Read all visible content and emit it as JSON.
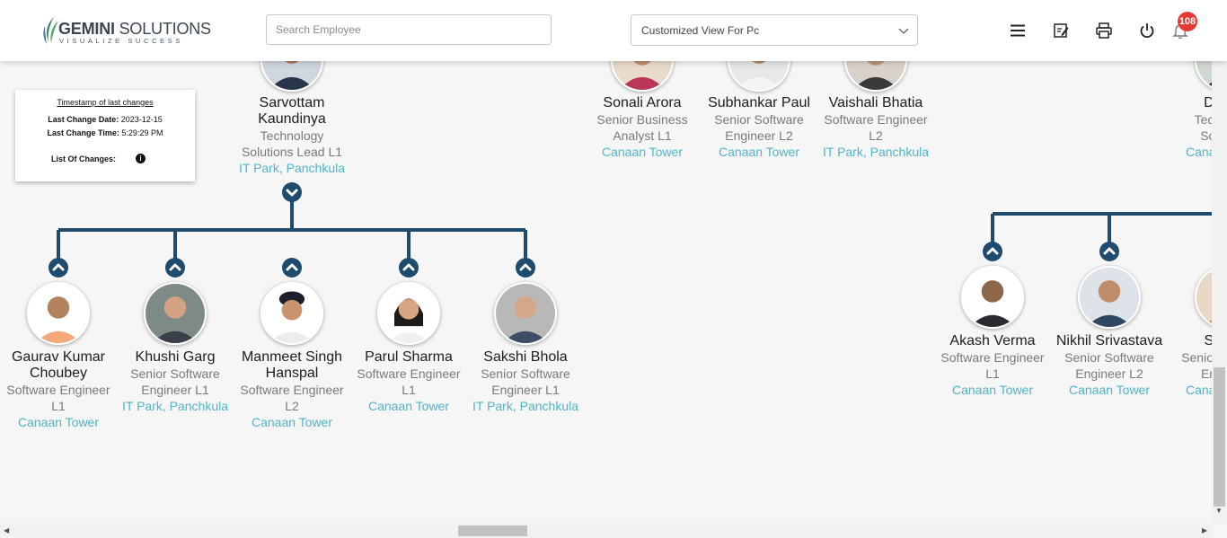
{
  "header": {
    "brand_name_bold": "GEMINI",
    "brand_name_thin": "SOLUTIONS",
    "brand_tagline": "VISUALIZE SUCCESS",
    "search_placeholder": "Search Employee",
    "view_selected": "Customized View For Pc",
    "notification_count": "108",
    "icons": [
      "menu-icon",
      "edit-note-icon",
      "printer-icon",
      "power-icon",
      "bell-icon"
    ]
  },
  "timestamp_card": {
    "title": "Timestamp of last changes",
    "date_label": "Last Change Date:",
    "date_value": "2023-12-15",
    "time_label": "Last Change Time:",
    "time_value": "5:29:29 PM",
    "changes_label": "List Of Changes:"
  },
  "top_row": [
    {
      "name": "Sarvottam Kaundinya",
      "designation": "Technology Solutions Lead L1",
      "location": "IT Park, Panchkula"
    },
    {
      "name": "Sonali Arora",
      "designation": "Senior Business Analyst L1",
      "location": "Canaan Tower"
    },
    {
      "name": "Subhankar Paul",
      "designation": "Senior Software Engineer L2",
      "location": "Canaan Tower"
    },
    {
      "name": "Vaishali Bhatia",
      "designation": "Software Engineer L2",
      "location": "IT Park, Panchkula"
    },
    {
      "name": "Danish",
      "designation": "Technology Solutions",
      "location": "Canaan Tower"
    }
  ],
  "team_left": [
    {
      "name": "Gaurav Kumar Choubey",
      "designation": "Software Engineer L1",
      "location": "Canaan Tower"
    },
    {
      "name": "Khushi Garg",
      "designation": "Senior Software Engineer L1",
      "location": "IT Park, Panchkula"
    },
    {
      "name": "Manmeet Singh Hanspal",
      "designation": "Software Engineer L2",
      "location": "Canaan Tower"
    },
    {
      "name": "Parul Sharma",
      "designation": "Software Engineer L1",
      "location": "Canaan Tower"
    },
    {
      "name": "Sakshi Bhola",
      "designation": "Senior Software Engineer L1",
      "location": "IT Park, Panchkula"
    }
  ],
  "team_right": [
    {
      "name": "Akash Verma",
      "designation": "Software Engineer L1",
      "location": "Canaan Tower"
    },
    {
      "name": "Nikhil Srivastava",
      "designation": "Senior Software Engineer L2",
      "location": "Canaan Tower"
    },
    {
      "name": "Shikha",
      "designation": "Senior Software Engineer",
      "location": "Canaan Tower"
    }
  ],
  "colors": {
    "connector": "#1e4b6e",
    "location_text": "#4fb5c7",
    "badge": "#e53935"
  }
}
